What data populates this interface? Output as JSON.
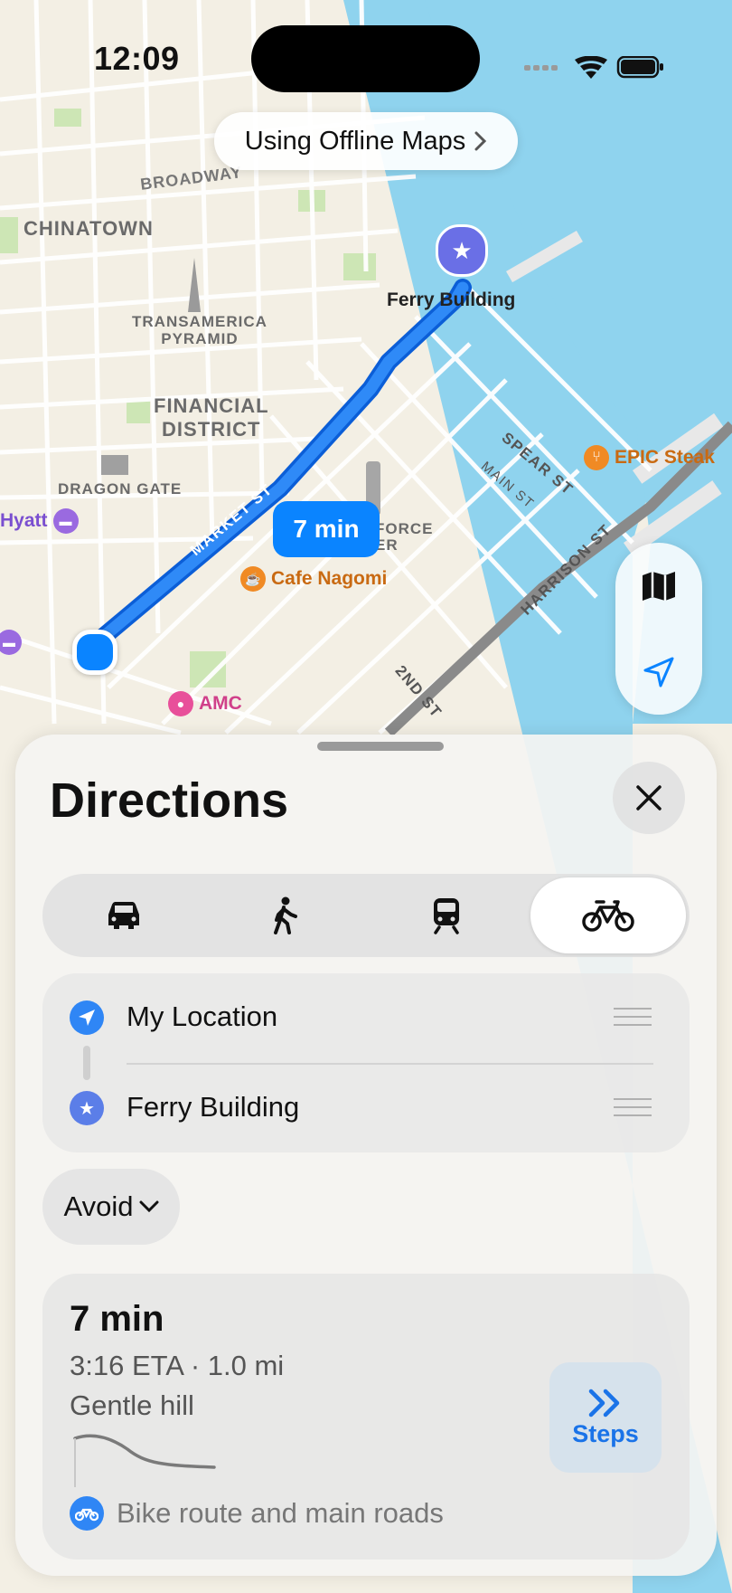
{
  "status_bar": {
    "time": "12:09"
  },
  "banner": {
    "label": "Using Offline Maps",
    "chevron": "chevron-right-icon"
  },
  "map": {
    "labels": {
      "chinatown": "CHINATOWN",
      "broadway": "BROADWAY",
      "transamerica": "TRANSAMERICA\nPYRAMID",
      "financial": "FINANCIAL\nDISTRICT",
      "dragon_gate": "DRAGON GATE",
      "market_st": "MARKET ST",
      "spear_st": "SPEAR ST",
      "main_st": "MAIN ST",
      "harrison_st": "HARRISON ST",
      "second_st": "2ND ST",
      "salesforce": "FORCE\nER"
    },
    "pois": {
      "ferry_building": "Ferry Building",
      "epic_steak": "EPIC Steak",
      "hyatt": "Hyatt",
      "cafe": "Cafe Nagomi",
      "amc": "AMC"
    },
    "route_time": "7 min",
    "colors": {
      "route": "#1273ee",
      "water": "#8fd3ee",
      "land": "#f3efe4",
      "park": "#cde6b5"
    }
  },
  "map_controls": {
    "map_icon": "map-icon",
    "location_icon": "location-arrow-icon"
  },
  "sheet": {
    "title": "Directions",
    "close_icon": "close-icon",
    "modes": [
      {
        "name": "car",
        "icon": "car-icon",
        "selected": false
      },
      {
        "name": "walk",
        "icon": "walk-icon",
        "selected": false
      },
      {
        "name": "transit",
        "icon": "train-icon",
        "selected": false
      },
      {
        "name": "bike",
        "icon": "bike-icon",
        "selected": true
      }
    ],
    "origin": "My Location",
    "destination": "Ferry Building",
    "avoid_label": "Avoid",
    "result": {
      "time": "7 min",
      "eta": "3:16 ETA · 1.0 mi",
      "terrain": "Gentle hill",
      "description": "Bike route and main roads",
      "steps_label": "Steps"
    }
  }
}
